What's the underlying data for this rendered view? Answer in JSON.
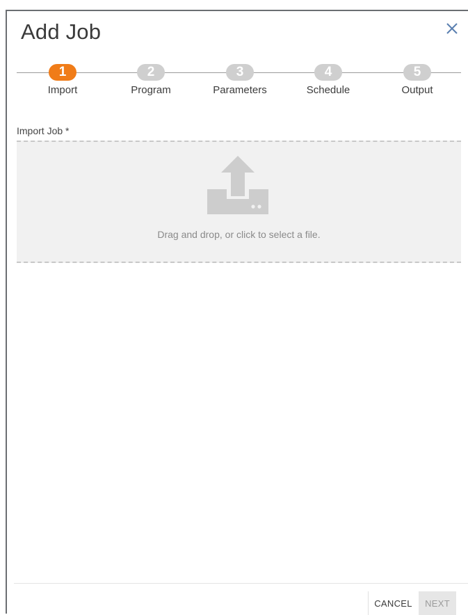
{
  "dialog": {
    "title": "Add Job",
    "close_icon": "close-icon"
  },
  "stepper": {
    "steps": [
      {
        "number": "1",
        "label": "Import",
        "active": true
      },
      {
        "number": "2",
        "label": "Program",
        "active": false
      },
      {
        "number": "3",
        "label": "Parameters",
        "active": false
      },
      {
        "number": "4",
        "label": "Schedule",
        "active": false
      },
      {
        "number": "5",
        "label": "Output",
        "active": false
      }
    ]
  },
  "import": {
    "label": "Import Job *",
    "drop_text": "Drag and drop, or click to select a file.",
    "icon": "upload-icon"
  },
  "footer": {
    "cancel_label": "CANCEL",
    "next_label": "NEXT"
  },
  "colors": {
    "accent": "#f07c18",
    "inactive_step": "#cfcfcf",
    "close_icon": "#5a7fb0"
  }
}
